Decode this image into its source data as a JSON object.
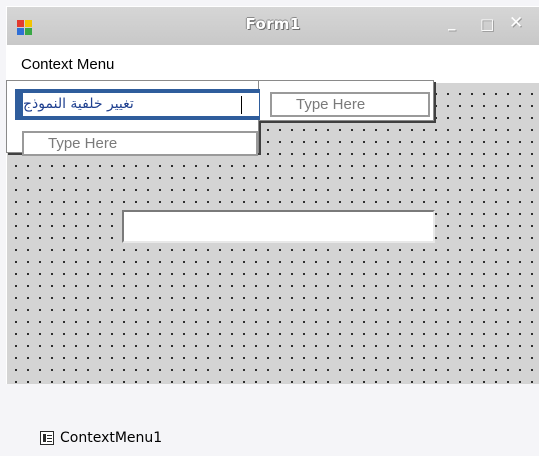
{
  "window": {
    "title": "Form1",
    "controls": {
      "minimize": "_",
      "maximize": "□",
      "close": "✕"
    }
  },
  "menubar": {
    "label": "Context Menu"
  },
  "context_menu": {
    "selected_item_text": "تغيير خلفية النموذج",
    "submenu_placeholder": "Type Here",
    "next_item_placeholder": "Type Here"
  },
  "tray": {
    "component_label": "ContextMenu1"
  },
  "icons": {
    "app": "windows-form-icon",
    "tray_component": "context-menu-component-icon"
  },
  "colors": {
    "selection": "#2f5d9c",
    "designer_surface": "#d4d4d4",
    "placeholder_text": "#7a7a7a"
  }
}
